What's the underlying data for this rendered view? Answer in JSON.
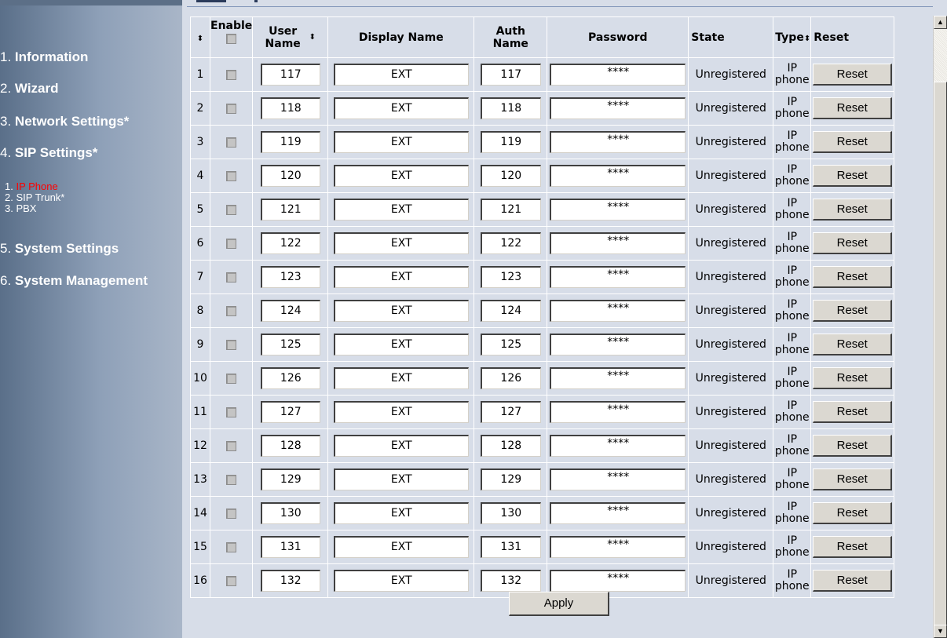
{
  "sidebar": {
    "items": [
      {
        "num": "1.",
        "label": "Information"
      },
      {
        "num": "2.",
        "label": "Wizard"
      },
      {
        "num": "3.",
        "label": "Network Settings*"
      },
      {
        "num": "4.",
        "label": "SIP Settings*"
      },
      {
        "num": "5.",
        "label": "System Settings"
      },
      {
        "num": "6.",
        "label": "System Management"
      }
    ],
    "sub_items": [
      {
        "num": "1.",
        "label": "IP Phone",
        "active": true
      },
      {
        "num": "2.",
        "label": "SIP Trunk*",
        "active": false
      },
      {
        "num": "3.",
        "label": "PBX",
        "active": false
      }
    ]
  },
  "table": {
    "headers": {
      "index_sort": "⬍",
      "enable": "Enable",
      "user_name_1": "User",
      "user_name_2": "Name",
      "user_sort": "⬍",
      "display_name": "Display Name",
      "auth_name_1": "Auth",
      "auth_name_2": "Name",
      "password": "Password",
      "state": "State",
      "type": "Type",
      "type_sort": "⬍",
      "reset": "Reset"
    },
    "rows": [
      {
        "idx": "1",
        "user": "117",
        "display": "EXT",
        "auth": "117",
        "password": "****",
        "state": "Unregistered",
        "type_1": "IP",
        "type_2": "phone",
        "reset": "Reset"
      },
      {
        "idx": "2",
        "user": "118",
        "display": "EXT",
        "auth": "118",
        "password": "****",
        "state": "Unregistered",
        "type_1": "IP",
        "type_2": "phone",
        "reset": "Reset"
      },
      {
        "idx": "3",
        "user": "119",
        "display": "EXT",
        "auth": "119",
        "password": "****",
        "state": "Unregistered",
        "type_1": "IP",
        "type_2": "phone",
        "reset": "Reset"
      },
      {
        "idx": "4",
        "user": "120",
        "display": "EXT",
        "auth": "120",
        "password": "****",
        "state": "Unregistered",
        "type_1": "IP",
        "type_2": "phone",
        "reset": "Reset"
      },
      {
        "idx": "5",
        "user": "121",
        "display": "EXT",
        "auth": "121",
        "password": "****",
        "state": "Unregistered",
        "type_1": "IP",
        "type_2": "phone",
        "reset": "Reset"
      },
      {
        "idx": "6",
        "user": "122",
        "display": "EXT",
        "auth": "122",
        "password": "****",
        "state": "Unregistered",
        "type_1": "IP",
        "type_2": "phone",
        "reset": "Reset"
      },
      {
        "idx": "7",
        "user": "123",
        "display": "EXT",
        "auth": "123",
        "password": "****",
        "state": "Unregistered",
        "type_1": "IP",
        "type_2": "phone",
        "reset": "Reset"
      },
      {
        "idx": "8",
        "user": "124",
        "display": "EXT",
        "auth": "124",
        "password": "****",
        "state": "Unregistered",
        "type_1": "IP",
        "type_2": "phone",
        "reset": "Reset"
      },
      {
        "idx": "9",
        "user": "125",
        "display": "EXT",
        "auth": "125",
        "password": "****",
        "state": "Unregistered",
        "type_1": "IP",
        "type_2": "phone",
        "reset": "Reset"
      },
      {
        "idx": "10",
        "user": "126",
        "display": "EXT",
        "auth": "126",
        "password": "****",
        "state": "Unregistered",
        "type_1": "IP",
        "type_2": "phone",
        "reset": "Reset"
      },
      {
        "idx": "11",
        "user": "127",
        "display": "EXT",
        "auth": "127",
        "password": "****",
        "state": "Unregistered",
        "type_1": "IP",
        "type_2": "phone",
        "reset": "Reset"
      },
      {
        "idx": "12",
        "user": "128",
        "display": "EXT",
        "auth": "128",
        "password": "****",
        "state": "Unregistered",
        "type_1": "IP",
        "type_2": "phone",
        "reset": "Reset"
      },
      {
        "idx": "13",
        "user": "129",
        "display": "EXT",
        "auth": "129",
        "password": "****",
        "state": "Unregistered",
        "type_1": "IP",
        "type_2": "phone",
        "reset": "Reset"
      },
      {
        "idx": "14",
        "user": "130",
        "display": "EXT",
        "auth": "130",
        "password": "****",
        "state": "Unregistered",
        "type_1": "IP",
        "type_2": "phone",
        "reset": "Reset"
      },
      {
        "idx": "15",
        "user": "131",
        "display": "EXT",
        "auth": "131",
        "password": "****",
        "state": "Unregistered",
        "type_1": "IP",
        "type_2": "phone",
        "reset": "Reset"
      },
      {
        "idx": "16",
        "user": "132",
        "display": "EXT",
        "auth": "132",
        "password": "****",
        "state": "Unregistered",
        "type_1": "IP",
        "type_2": "phone",
        "reset": "Reset"
      }
    ]
  },
  "apply_label": "Apply",
  "colors": {
    "active_submenu": "#ff0000",
    "content_bg": "#d7dde8",
    "button_face": "#dbd8d1"
  },
  "icons": {
    "sort": "sort-arrows-icon",
    "scroll_up": "scroll-up-arrow-icon",
    "scroll_down": "scroll-down-arrow-icon"
  }
}
